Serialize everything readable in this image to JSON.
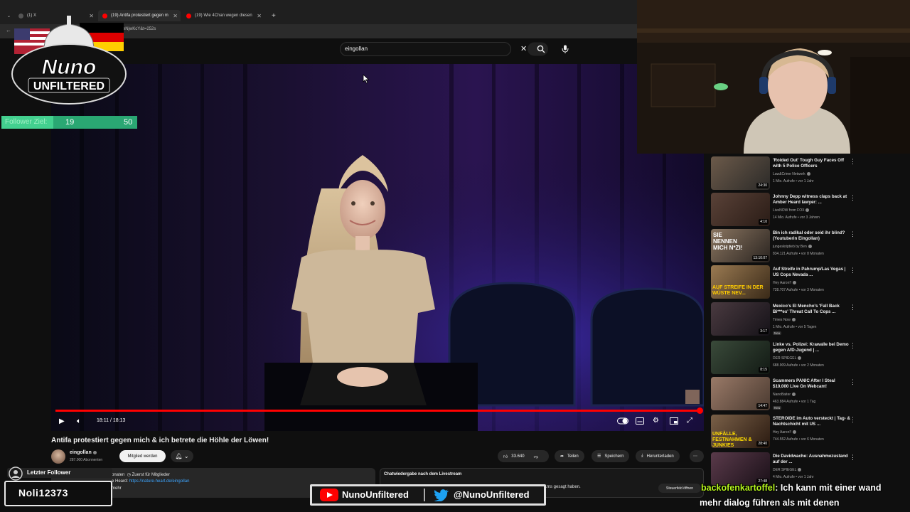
{
  "browser": {
    "tabs": [
      {
        "label": "(1) X"
      },
      {
        "label": "(19) Antifa protestiert gegen m"
      },
      {
        "label": "(19) Wie 4Chan wegen diesen"
      }
    ],
    "new_tab": "+",
    "url": "watch?v=qajdeNjwKcY&t=252s"
  },
  "youtube": {
    "search_value": "eingollan",
    "player": {
      "time": "18:11 / 18:13",
      "progress": 0.998
    },
    "video_title": "Antifa protestiert gegen mich & ich betrete die Höhle der Löwen!",
    "channel": {
      "name": "eingollan",
      "subscribers": "287.000 Abonnenten",
      "join_label": "Mitglied werden"
    },
    "actions": {
      "likes": "33.640",
      "share": "Teilen",
      "save": "Speichern",
      "download": "Herunterladen"
    },
    "description": {
      "line1_a": "...onaten",
      "line1_b": "Zuerst für Mitglieder",
      "line2_prefix": "...e Heard:",
      "line2_link": "https://nature-heart.de/eingollan",
      "line3": "...mehr"
    },
    "chat": {
      "label": "Chatwiedergabe nach dem Livestream",
      "snippet": "...ms gesagt haben.",
      "open_label": "Steuerfeld öffnen"
    },
    "recommended": [
      {
        "title": "'Roided Out' Tough Guy Faces Off with 5 Police Officers",
        "channel": "Law&Crime Network",
        "meta": "1 Mio. Aufrufe • vor 1 Jahr",
        "duration": "24:30",
        "badge": ""
      },
      {
        "title": "Johnny Depp witness claps back at Amber Heard lawyer: ...",
        "channel": "LiveNOW from FOX",
        "meta": "14 Mio. Aufrufe • vor 3 Jahren",
        "duration": "4:10",
        "badge": ""
      },
      {
        "title": "Bin ich radikal oder seid ihr blind? (Youtuberin Eingollan)",
        "channel": "jungeskriptieb by Ben",
        "meta": "834.121 Aufrufe • vor 8 Monaten",
        "duration": "13:10:07",
        "badge": ""
      },
      {
        "title": "Auf Streife in Pahrump/Las Vegas | US Cops Nevada ...",
        "channel": "Hey Aaron!!",
        "meta": "728.707 Aufrufe • vor 3 Monaten",
        "duration": "",
        "badge": ""
      },
      {
        "title": "Mexico's El Mencho's 'Fall Back Bi***es' Threat Call To Cops ...",
        "channel": "Times Now",
        "meta": "1 Mio. Aufrufe • vor 5 Tagen",
        "duration": "3:17",
        "badge": "Neu"
      },
      {
        "title": "Linke vs. Polizei: Krawalle bei Demo gegen AfD-Jugend | ...",
        "channel": "DER SPIEGEL",
        "meta": "688.909 Aufrufe • vor 2 Monaten",
        "duration": "8:15",
        "badge": ""
      },
      {
        "title": "Scammers PANIC After I Steal $10,000 Live On Webcam!",
        "channel": "NanoBaiter",
        "meta": "463.884 Aufrufe • vor 1 Tag",
        "duration": "14:47",
        "badge": "Neu"
      },
      {
        "title": "STEROIDE im Auto versteckt | Tag- & Nachtschicht mit US ...",
        "channel": "Hey Aaron!!",
        "meta": "744.552 Aufrufe • vor 6 Monaten",
        "duration": "28:40",
        "badge": ""
      },
      {
        "title": "Die Davidwache: Ausnahmezustand auf der ...",
        "channel": "DER SPIEGEL",
        "meta": "4 Mio. Aufrufe • vor 1 Jahr",
        "duration": "27:48",
        "badge": ""
      }
    ],
    "thumb_text": {
      "t3": "SIE NENNEN MICH N*ZI!",
      "t4": "AUF STREIFE IN DER WÜSTE NEV...",
      "t8": "UNFÄLLE, FESTNAHMEN & JUNKIES"
    }
  },
  "overlay": {
    "logo_line1": "Nuno",
    "logo_line2": "UNFILTERED",
    "goal": {
      "label": "Follower Ziel:",
      "current": "19",
      "target": "50",
      "progress": 0.38
    },
    "last_follower_label": "Letzter Follower",
    "last_follower_name": "Noli12373",
    "social_youtube": "NunoUnfiltered",
    "social_twitter": "@NunoUnfiltered",
    "chat_user": "backofenkartoffel",
    "chat_msg_1": ": Ich kann mit einer wand",
    "chat_msg_2": "mehr dialog führen als mit denen"
  },
  "colors": {
    "accent_red": "#ff0000",
    "goal_green": "#2aa773",
    "chat_user_green": "#b6f51e",
    "link_blue": "#3ea6ff"
  }
}
